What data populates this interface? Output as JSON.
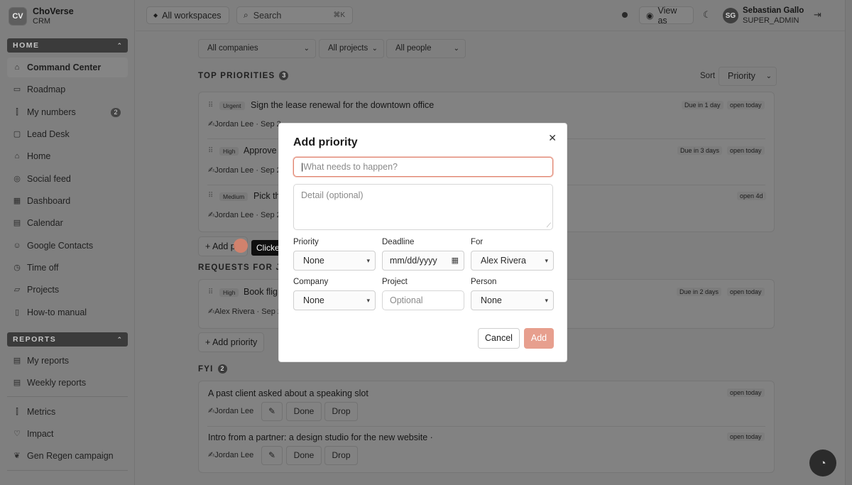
{
  "brand": {
    "logo": "CV",
    "name": "ChoVerse",
    "sub": "CRM"
  },
  "sidebar": {
    "home_header": "HOME",
    "home_items": [
      {
        "label": "Command Center",
        "icon": "home-icon"
      },
      {
        "label": "Roadmap",
        "icon": "roadmap-icon"
      },
      {
        "label": "My numbers",
        "icon": "chart-icon",
        "badge": "2"
      },
      {
        "label": "Lead Desk",
        "icon": "inbox-icon"
      },
      {
        "label": "Home",
        "icon": "house-icon"
      },
      {
        "label": "Social feed",
        "icon": "feed-icon"
      },
      {
        "label": "Dashboard",
        "icon": "dashboard-icon"
      },
      {
        "label": "Calendar",
        "icon": "calendar-icon"
      },
      {
        "label": "Google Contacts",
        "icon": "contacts-icon"
      },
      {
        "label": "Time off",
        "icon": "clock-icon"
      },
      {
        "label": "Projects",
        "icon": "folder-icon"
      },
      {
        "label": "How-to manual",
        "icon": "book-icon"
      }
    ],
    "reports_header": "REPORTS",
    "report_items": [
      {
        "label": "My reports",
        "icon": "report-icon"
      },
      {
        "label": "Weekly reports",
        "icon": "calendar-icon"
      }
    ],
    "other_items": [
      {
        "label": "Metrics",
        "icon": "metrics-icon"
      },
      {
        "label": "Impact",
        "icon": "heart-icon"
      },
      {
        "label": "Gen Regen campaign",
        "icon": "leaf-icon"
      }
    ]
  },
  "topbar": {
    "workspaces": "All workspaces",
    "search_placeholder": "Search",
    "search_shortcut": "⌘K",
    "view_as": "View as",
    "user_initials": "SG",
    "user_name": "Sebastian Gallo",
    "user_role": "SUPER_ADMIN"
  },
  "filters": {
    "companies": "All companies",
    "projects": "All projects",
    "people": "All people"
  },
  "sort": {
    "label": "Sort",
    "value": "Priority"
  },
  "top_priorities": {
    "title": "TOP PRIORITIES",
    "count": "3",
    "rows": [
      {
        "tag": "Urgent",
        "title": "Sign the lease renewal for the downtown office",
        "meta": "Jordan Lee · Sep 2",
        "due": "Due in 1 day",
        "open": "open today"
      },
      {
        "tag": "High",
        "title": "Approve t",
        "meta": "Jordan Lee · Sep 2",
        "due": "Due in 3 days",
        "open": "open today"
      },
      {
        "tag": "Medium",
        "title": "Pick th",
        "meta": "Jordan Lee · Sep 2",
        "due": "",
        "open": "open 4d"
      }
    ],
    "add_label": "+ Add p"
  },
  "requests": {
    "title": "REQUESTS FOR JORD",
    "rows": [
      {
        "tag": "High",
        "title": "Book flig",
        "meta": "Alex Rivera · Sep 2",
        "due": "Due in 2 days",
        "open": "open today"
      }
    ],
    "add_label": "+ Add priority"
  },
  "fyi": {
    "title": "FYI",
    "count": "2",
    "rows": [
      {
        "title": "A past client asked about a speaking slot",
        "meta": "Jordan Lee",
        "open": "open today",
        "edit": "✎",
        "done": "Done",
        "drop": "Drop"
      },
      {
        "title": "Intro from a partner: a design studio for the new website ·",
        "meta": "Jordan Lee",
        "open": "open today",
        "edit": "✎",
        "done": "Done",
        "drop": "Drop"
      }
    ]
  },
  "click_indicator": {
    "label": "Clicked"
  },
  "modal": {
    "title": "Add priority",
    "title_placeholder": "What needs to happen?",
    "detail_placeholder": "Detail (optional)",
    "priority_label": "Priority",
    "priority_value": "None",
    "deadline_label": "Deadline",
    "deadline_value": "mm/dd/yyyy",
    "for_label": "For",
    "for_value": "Alex Rivera",
    "company_label": "Company",
    "company_value": "None",
    "project_label": "Project",
    "project_placeholder": "Optional",
    "person_label": "Person",
    "person_value": "None",
    "cancel": "Cancel",
    "add": "Add"
  }
}
